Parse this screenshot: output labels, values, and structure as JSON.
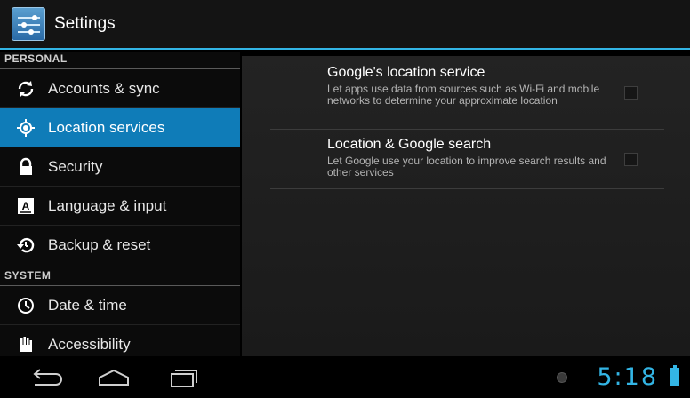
{
  "actionbar": {
    "title": "Settings",
    "icon": "settings-app-icon"
  },
  "sidebar": {
    "sections": [
      {
        "header": "PERSONAL",
        "items": [
          {
            "label": "Accounts & sync",
            "icon": "sync-icon"
          },
          {
            "label": "Location services",
            "icon": "location-icon",
            "selected": true
          },
          {
            "label": "Security",
            "icon": "lock-icon"
          },
          {
            "label": "Language & input",
            "icon": "keyboard-icon"
          },
          {
            "label": "Backup & reset",
            "icon": "backup-icon"
          }
        ]
      },
      {
        "header": "SYSTEM",
        "items": [
          {
            "label": "Date & time",
            "icon": "clock-icon"
          },
          {
            "label": "Accessibility",
            "icon": "hand-icon"
          }
        ]
      }
    ]
  },
  "main": {
    "prefs": [
      {
        "title": "Google's location service",
        "summary": "Let apps use data from sources such as Wi-Fi and mobile networks to determine your approximate location",
        "checked": false
      },
      {
        "title": "Location & Google search",
        "summary": "Let Google use your location to improve search results and other services",
        "checked": false
      }
    ]
  },
  "navbar": {
    "time": "5:18",
    "accent": "#33b5e5"
  }
}
